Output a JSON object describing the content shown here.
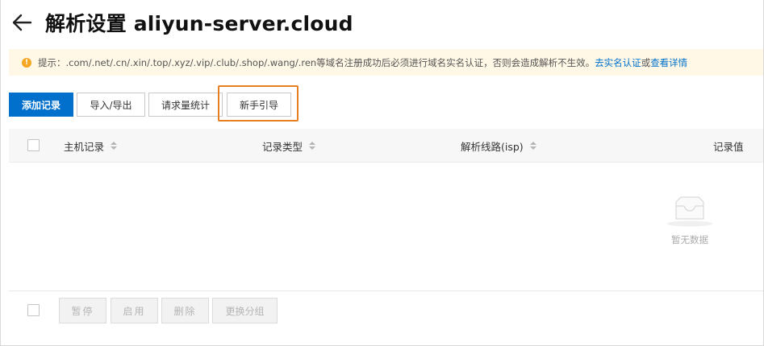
{
  "header": {
    "title": "解析设置 aliyun-server.cloud",
    "back_icon": "arrow-left-icon"
  },
  "notice": {
    "icon": "warning-icon",
    "icon_color": "#f5a623",
    "text": "提示：.com/.net/.cn/.xin/.top/.xyz/.vip/.club/.shop/.wang/.ren等域名注册成功后必须进行域名实名认证，否则会造成解析不生效。",
    "link1": "去实名认证",
    "conj": "或",
    "link2": "查看详情"
  },
  "toolbar": {
    "add_record": "添加记录",
    "import_export": "导入/导出",
    "request_stats": "请求量统计",
    "guide": "新手引导",
    "primary_color": "#0070cc",
    "highlight_color": "#e67e22"
  },
  "table": {
    "columns": {
      "host": "主机记录",
      "type": "记录类型",
      "line": "解析线路(isp)",
      "value": "记录值"
    },
    "empty_text": "暂无数据"
  },
  "footer": {
    "pause": "暂停",
    "enable": "启用",
    "delete": "删除",
    "change_group": "更换分组"
  }
}
